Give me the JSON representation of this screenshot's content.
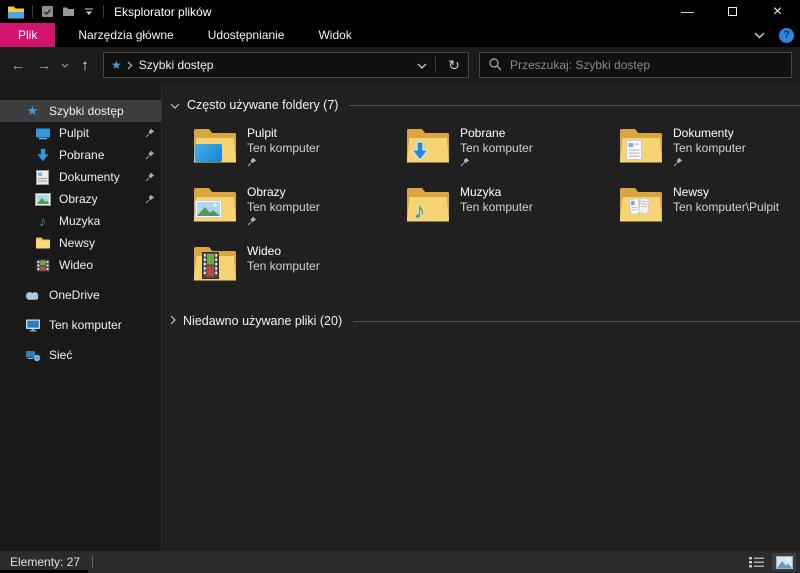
{
  "window": {
    "title": "Eksplorator plików"
  },
  "ribbon": {
    "file_tab": "Plik",
    "tabs": [
      {
        "label": "Narzędzia główne"
      },
      {
        "label": "Udostępnianie"
      },
      {
        "label": "Widok"
      }
    ]
  },
  "address_bar": {
    "path": "Szybki dostęp",
    "search_placeholder": "Przeszukaj: Szybki dostęp"
  },
  "sidebar": {
    "items": [
      {
        "label": "Szybki dostęp",
        "icon": "quick-access-star",
        "selected": true
      },
      {
        "label": "Pulpit",
        "icon": "desktop-monitor",
        "pinned": true
      },
      {
        "label": "Pobrane",
        "icon": "download-arrow",
        "pinned": true
      },
      {
        "label": "Dokumenty",
        "icon": "document-page",
        "pinned": true
      },
      {
        "label": "Obrazy",
        "icon": "picture",
        "pinned": true
      },
      {
        "label": "Muzyka",
        "icon": "music-note",
        "pinned": false
      },
      {
        "label": "Newsy",
        "icon": "folder",
        "pinned": false
      },
      {
        "label": "Wideo",
        "icon": "filmstrip",
        "pinned": false
      },
      {
        "label": "OneDrive",
        "icon": "cloud",
        "pinned": false
      },
      {
        "label": "Ten komputer",
        "icon": "computer",
        "pinned": false
      },
      {
        "label": "Sieć",
        "icon": "network",
        "pinned": false
      }
    ]
  },
  "main": {
    "sections": [
      {
        "title": "Często używane foldery (7)",
        "expanded": true
      },
      {
        "title": "Niedawno używane pliki (20)",
        "expanded": false
      }
    ],
    "folders": [
      {
        "name": "Pulpit",
        "location": "Ten komputer",
        "pinned": true,
        "icon": "folder-desktop"
      },
      {
        "name": "Pobrane",
        "location": "Ten komputer",
        "pinned": true,
        "icon": "folder-downloads"
      },
      {
        "name": "Dokumenty",
        "location": "Ten komputer",
        "pinned": true,
        "icon": "folder-documents"
      },
      {
        "name": "Obrazy",
        "location": "Ten komputer",
        "pinned": true,
        "icon": "folder-pictures"
      },
      {
        "name": "Muzyka",
        "location": "Ten komputer",
        "pinned": false,
        "icon": "folder-music"
      },
      {
        "name": "Newsy",
        "location": "Ten komputer\\Pulpit",
        "pinned": false,
        "icon": "folder-files"
      },
      {
        "name": "Wideo",
        "location": "Ten komputer",
        "pinned": false,
        "icon": "folder-video"
      }
    ]
  },
  "status_bar": {
    "items_count": "Elementy: 27"
  },
  "glyphs": {
    "back": "←",
    "forward": "→",
    "up": "↑",
    "refresh": "↻",
    "minimize": "—",
    "close": "×",
    "star": "★",
    "music_note": "♪",
    "help": "?"
  },
  "colors": {
    "file_tab": "#d4136e",
    "accent_blue": "#2f9be0",
    "folder_back": "#dca43f",
    "folder_front": "#f6d474",
    "selected_row": "#3d3d3d"
  }
}
